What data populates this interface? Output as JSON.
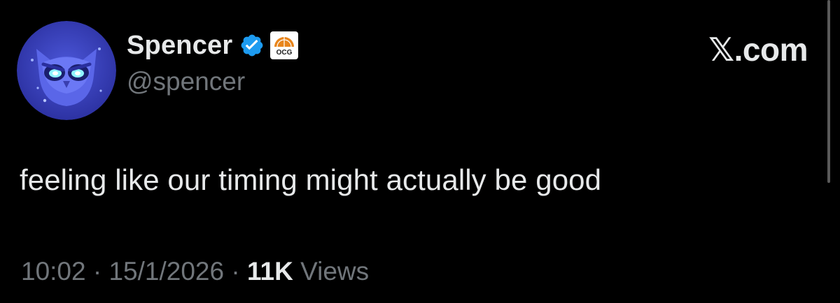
{
  "author": {
    "display_name": "Spencer",
    "handle": "@spencer",
    "verified_icon": "verified-badge-icon",
    "affiliation_icon": "affiliation-badge-icon",
    "affiliation_text": "OCG",
    "avatar_icon": "owl-avatar"
  },
  "brand": {
    "label": "𝕏.com"
  },
  "tweet": {
    "text": "feeling like our timing might actually be good",
    "time": "10:02",
    "separator": "·",
    "date": "15/1/2026",
    "views_count": "11K",
    "views_label": "Views"
  },
  "colors": {
    "background": "#000000",
    "primary_text": "#e7e9ea",
    "secondary_text": "#71767b",
    "verified_blue": "#1d9bf0",
    "affiliation_orange": "#e8851c"
  }
}
